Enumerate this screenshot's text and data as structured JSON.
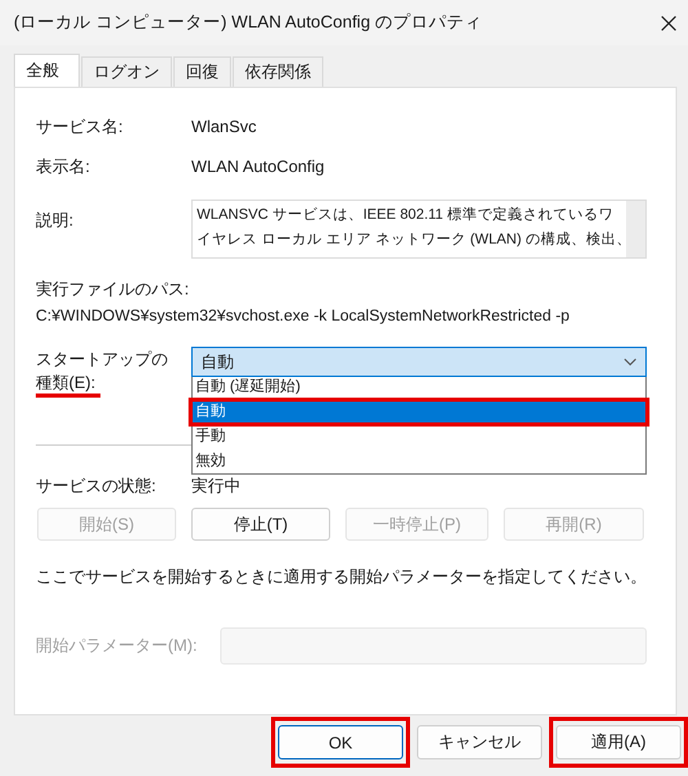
{
  "window": {
    "title": "(ローカル コンピューター) WLAN AutoConfig のプロパティ"
  },
  "tabs": [
    {
      "label": "全般",
      "selected": true
    },
    {
      "label": "ログオン",
      "selected": false
    },
    {
      "label": "回復",
      "selected": false
    },
    {
      "label": "依存関係",
      "selected": false
    }
  ],
  "general": {
    "fields": [
      {
        "label": "サービス名:",
        "value": "WlanSvc"
      },
      {
        "label": "表示名:",
        "value": "WLAN AutoConfig"
      }
    ],
    "description": {
      "label": "説明:",
      "lines": [
        "WLANSVC サービスは、IEEE 802.11 標準で定義されているワ",
        "イヤレス ローカル エリア ネットワーク (WLAN) の構成、検出、"
      ]
    },
    "path": {
      "label": "実行ファイルのパス:",
      "value": "C:¥WINDOWS¥system32¥svchost.exe -k LocalSystemNetworkRestricted -p"
    },
    "startup": {
      "label_lines": [
        "スタートアップの",
        "種類(E):"
      ],
      "underlined": true,
      "value": "自動",
      "expanded": true,
      "options": [
        {
          "label": "自動 (遅延開始)",
          "selected": false,
          "highlighted": false
        },
        {
          "label": "自動",
          "selected": true,
          "highlighted": true
        },
        {
          "label": "手動",
          "selected": false,
          "highlighted": false
        },
        {
          "label": "無効",
          "selected": false,
          "highlighted": false
        }
      ]
    },
    "status": {
      "label": "サービスの状態:",
      "value": "実行中"
    },
    "service_buttons": [
      {
        "label": "開始(S)",
        "disabled": true
      },
      {
        "label": "停止(T)",
        "disabled": false
      },
      {
        "label": "一時停止(P)",
        "disabled": true
      },
      {
        "label": "再開(R)",
        "disabled": true
      }
    ],
    "hint": "ここでサービスを開始するときに適用する開始パラメーターを指定してください。",
    "parameters": {
      "label": "開始パラメーター(M):",
      "disabled": true
    }
  },
  "buttons": [
    {
      "label": "OK",
      "default": true,
      "highlighted": true
    },
    {
      "label": "キャンセル",
      "default": false,
      "highlighted": false
    },
    {
      "label": "適用(A)",
      "default": false,
      "highlighted": true
    }
  ]
}
